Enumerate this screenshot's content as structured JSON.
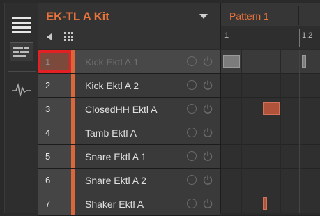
{
  "sidebar": {
    "buttons": [
      {
        "icon": "list-view-icon"
      },
      {
        "icon": "mixer-view-icon"
      },
      {
        "icon": "waveform-icon"
      }
    ]
  },
  "group": {
    "title": "EK-TL A Kit",
    "tools": [
      "speaker-icon",
      "grid-icon"
    ]
  },
  "pattern": {
    "title": "Pattern 1",
    "ruler_labels": [
      "1",
      "1.2"
    ]
  },
  "sounds": [
    {
      "slot": "1",
      "name": "Kick Ektl A 1",
      "selected": true
    },
    {
      "slot": "2",
      "name": "Kick Ektl A 2",
      "selected": false
    },
    {
      "slot": "3",
      "name": "ClosedHH Ektl A",
      "selected": false
    },
    {
      "slot": "4",
      "name": "Tamb Ektl A",
      "selected": false
    },
    {
      "slot": "5",
      "name": "Snare Ektl A 1",
      "selected": false
    },
    {
      "slot": "6",
      "name": "Snare Ektl A 2",
      "selected": false
    },
    {
      "slot": "7",
      "name": "Shaker Ektl A",
      "selected": false
    }
  ],
  "colors": {
    "accent": "#e8733b",
    "sound_color": "#d9673a",
    "highlight": "#e32024"
  }
}
